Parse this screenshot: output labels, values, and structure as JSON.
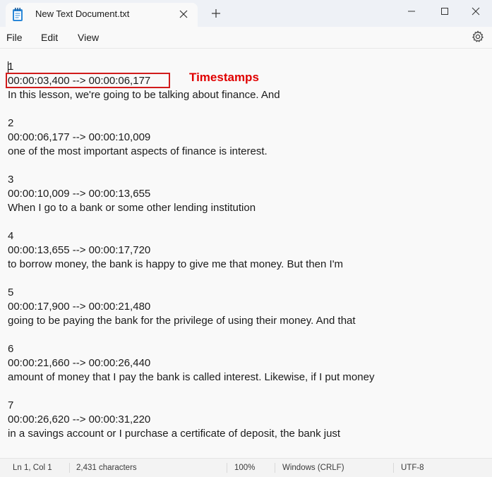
{
  "tab": {
    "title": "New Text Document.txt"
  },
  "menu": {
    "file": "File",
    "edit": "Edit",
    "view": "View"
  },
  "document": {
    "lines": [
      "1",
      "00:00:03,400 --> 00:00:06,177",
      "In this lesson, we're going to be talking about finance. And",
      "",
      "2",
      "00:00:06,177 --> 00:00:10,009",
      "one of the most important aspects of finance is interest.",
      "",
      "3",
      "00:00:10,009 --> 00:00:13,655",
      "When I go to a bank or some other lending institution",
      "",
      "4",
      "00:00:13,655 --> 00:00:17,720",
      "to borrow money, the bank is happy to give me that money. But then I'm",
      "",
      "5",
      "00:00:17,900 --> 00:00:21,480",
      "going to be paying the bank for the privilege of using their money. And that",
      "",
      "6",
      "00:00:21,660 --> 00:00:26,440",
      "amount of money that I pay the bank is called interest. Likewise, if I put money",
      "",
      "7",
      "00:00:26,620 --> 00:00:31,220",
      "in a savings account or I purchase a certificate of deposit, the bank just"
    ]
  },
  "annotation": {
    "label": "Timestamps",
    "color": "#e00000"
  },
  "status": {
    "position": "Ln 1, Col 1",
    "characters": "2,431 characters",
    "zoom": "100%",
    "line_ending": "Windows (CRLF)",
    "encoding": "UTF-8"
  },
  "icons": [
    "notepad-icon",
    "close-tab-icon",
    "new-tab-icon",
    "minimize-icon",
    "maximize-icon",
    "close-window-icon",
    "settings-gear-icon"
  ]
}
